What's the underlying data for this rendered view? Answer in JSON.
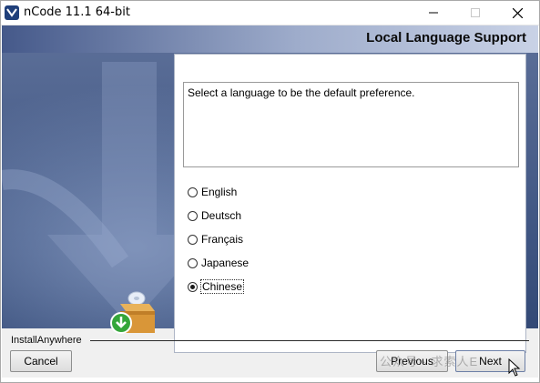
{
  "window": {
    "title": "nCode 11.1 64-bit"
  },
  "header": {
    "title": "Local Language Support"
  },
  "content": {
    "description": "Select a language to be the default preference.",
    "languages": [
      "English",
      "Deutsch",
      "Français",
      "Japanese",
      "Chinese"
    ],
    "selected": "Chinese"
  },
  "footer": {
    "brand": "InstallAnywhere",
    "cancel_label": "Cancel",
    "previous_label": "Previous",
    "next_label": "Next"
  },
  "watermark": {
    "text": "公众号 · 求索人E"
  },
  "colors": {
    "background_blue": "#4a5f8a",
    "accent": "#2a7fd4"
  }
}
